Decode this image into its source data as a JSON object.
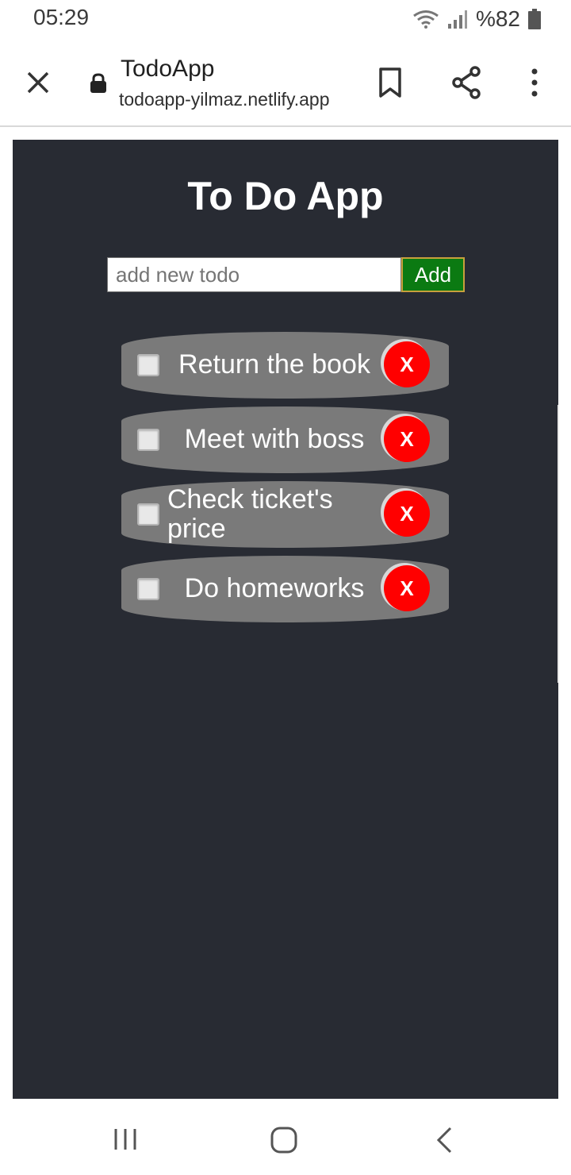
{
  "status_bar": {
    "time": "05:29",
    "battery_text": "%82",
    "icons": [
      "wifi-icon",
      "signal-icon",
      "battery-icon"
    ]
  },
  "tab_header": {
    "title": "TodoApp",
    "url": "todoapp-yilmaz.netlify.app",
    "icons": [
      "close-icon",
      "lock-icon",
      "bookmark-icon",
      "share-icon",
      "more-vert-icon"
    ]
  },
  "app": {
    "title": "To Do App",
    "input": {
      "placeholder": "add new todo",
      "value": ""
    },
    "add_label": "Add",
    "todos": [
      {
        "text": "Return the book",
        "checked": false,
        "delete_label": "X"
      },
      {
        "text": "Meet with boss",
        "checked": false,
        "delete_label": "X"
      },
      {
        "text": "Check ticket's price",
        "checked": false,
        "delete_label": "X"
      },
      {
        "text": "Do homeworks",
        "checked": false,
        "delete_label": "X"
      }
    ]
  },
  "colors": {
    "page_bg": "#282b33",
    "todo_bg": "#7a7a7a",
    "add_button": "#0b7a12",
    "delete_button": "#ff0000"
  }
}
